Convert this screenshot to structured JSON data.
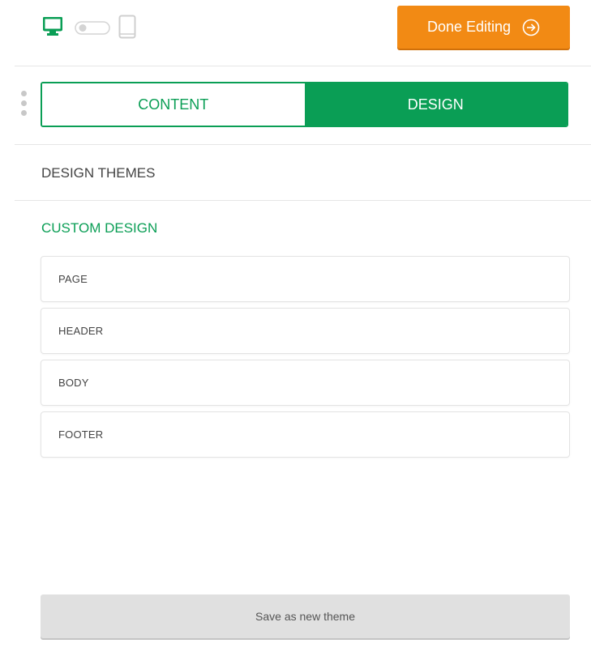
{
  "toolbar": {
    "device_icons": [
      "desktop-icon",
      "toggle-icon",
      "mobile-icon"
    ],
    "done_label": "Done Editing",
    "done_icon": "arrow-circle-right-icon"
  },
  "tabs": [
    {
      "label": "CONTENT",
      "active": false
    },
    {
      "label": "DESIGN",
      "active": true
    }
  ],
  "sections": {
    "themes_label": "DESIGN THEMES",
    "custom_label": "CUSTOM DESIGN"
  },
  "design_items": [
    "PAGE",
    "HEADER",
    "BODY",
    "FOOTER"
  ],
  "save_label": "Save as new theme",
  "colors": {
    "accent": "#0a9e55",
    "done_button": "#f28a14",
    "save_button": "#e0e0e0"
  }
}
